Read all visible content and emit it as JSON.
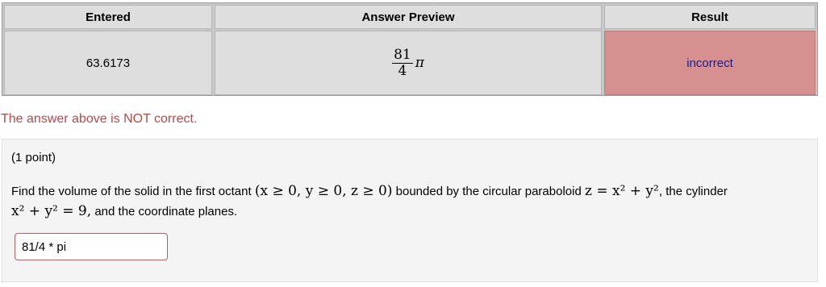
{
  "table": {
    "headers": [
      "Entered",
      "Answer Preview",
      "Result"
    ],
    "entered": "63.6173",
    "preview": {
      "numerator": "81",
      "denominator": "4",
      "symbol": "π"
    },
    "result": "incorrect",
    "result_color": "#d69090"
  },
  "status_message": "The answer above is NOT correct.",
  "problem": {
    "points": "(1 point)",
    "text_1": "Find the volume of the solid in the first octant",
    "math_1": "(x ≥ 0, y ≥ 0, z ≥ 0)",
    "text_2": "bounded by the circular paraboloid",
    "math_2": "z = x² + y²",
    "text_3": ", the cylinder",
    "math_3": "x² + y² = 9,",
    "text_4": "and the coordinate planes."
  },
  "answer": {
    "value": "81/4 * pi"
  }
}
